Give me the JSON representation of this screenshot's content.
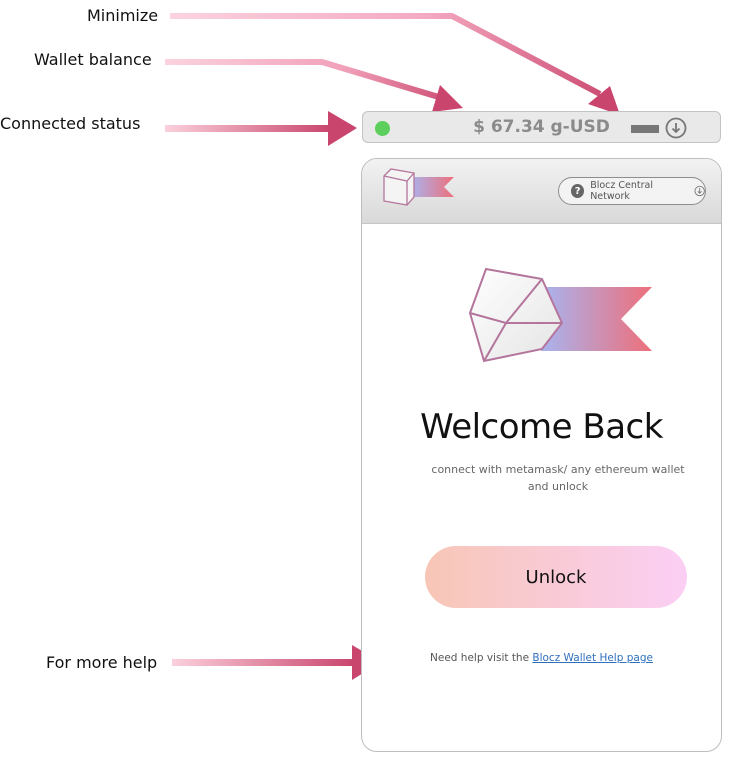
{
  "annotations": {
    "minimize": "Minimize",
    "wallet_balance": "Wallet balance",
    "connected_status": "Connected status",
    "more_help": "For more help"
  },
  "status_bar": {
    "balance": "$ 67.34 g-USD",
    "status_color": "#5ccf5c",
    "minimize_icon": "minimize-icon",
    "download_icon": "download-circle-icon"
  },
  "header": {
    "network_label": "Blocz Central Network",
    "network_icon": "question-circle-icon"
  },
  "main": {
    "title": "Welcome Back",
    "subtitle": "connect with metamask/ any ethereum wallet and unlock",
    "unlock_label": "Unlock",
    "help_text": "Need help visit the ",
    "help_link": "Blocz Wallet Help page"
  },
  "colors": {
    "arrow_dark": "#c9456d",
    "arrow_light": "#f7c9d4",
    "ribbon_start": "#a8b4f0",
    "ribbon_end": "#ee6f7a",
    "cube_stroke": "#b4759c"
  }
}
